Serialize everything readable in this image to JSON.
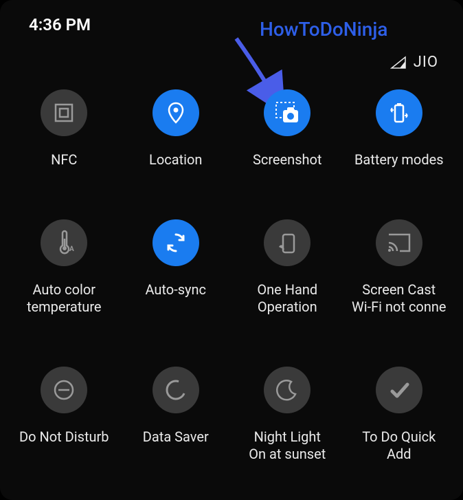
{
  "status": {
    "time": "4:36 PM",
    "carrier": "JIO"
  },
  "watermark": "HowToDoNinja",
  "tiles": [
    {
      "label": "NFC",
      "sublabel": "",
      "active": false,
      "icon": "nfc"
    },
    {
      "label": "Location",
      "sublabel": "",
      "active": true,
      "icon": "location"
    },
    {
      "label": "Screenshot",
      "sublabel": "",
      "active": true,
      "icon": "screenshot"
    },
    {
      "label": "Battery modes",
      "sublabel": "",
      "active": true,
      "icon": "battery"
    },
    {
      "label": "Auto color\ntemperature",
      "sublabel": "",
      "active": false,
      "icon": "thermo"
    },
    {
      "label": "Auto-sync",
      "sublabel": "",
      "active": true,
      "icon": "sync"
    },
    {
      "label": "One Hand\nOperation",
      "sublabel": "",
      "active": false,
      "icon": "onehand"
    },
    {
      "label": "Screen Cast",
      "sublabel": "Wi-Fi not conne",
      "active": false,
      "icon": "cast"
    },
    {
      "label": "Do Not Disturb",
      "sublabel": "",
      "active": false,
      "icon": "dnd"
    },
    {
      "label": "Data Saver",
      "sublabel": "",
      "active": false,
      "icon": "datasaver"
    },
    {
      "label": "Night Light",
      "sublabel": "On at sunset",
      "active": false,
      "icon": "nightlight"
    },
    {
      "label": "To Do Quick\nAdd",
      "sublabel": "",
      "active": false,
      "icon": "todo"
    }
  ],
  "colors": {
    "accent": "#1a7cf0",
    "tileOff": "#3a3a3a",
    "watermark": "#2e5fe8",
    "iconOff": "#9a9a9a",
    "iconOn": "#ffffff"
  }
}
